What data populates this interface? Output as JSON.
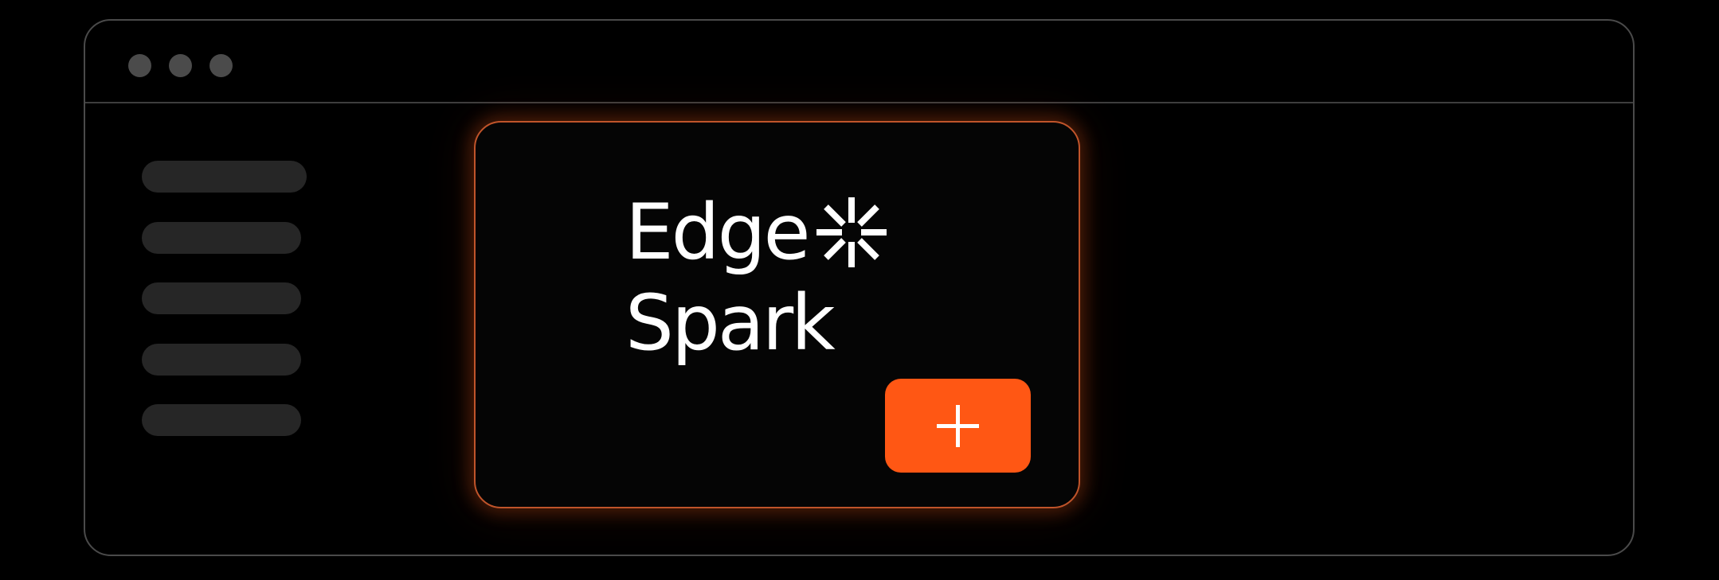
{
  "window": {
    "controls": [
      "close-dot",
      "minimize-dot",
      "maximize-dot"
    ]
  },
  "sidebar": {
    "item_count": 5
  },
  "card": {
    "logo": {
      "line1": "Edge",
      "line2": "Spark",
      "mark_icon": "spark-burst-icon"
    },
    "add_button": {
      "icon": "plus-icon"
    }
  },
  "colors": {
    "background": "#000000",
    "window_border": "#4a4a4a",
    "sidebar_item": "#262626",
    "card_border": "#c0542a",
    "accent": "#ff5714",
    "text": "#ffffff"
  }
}
